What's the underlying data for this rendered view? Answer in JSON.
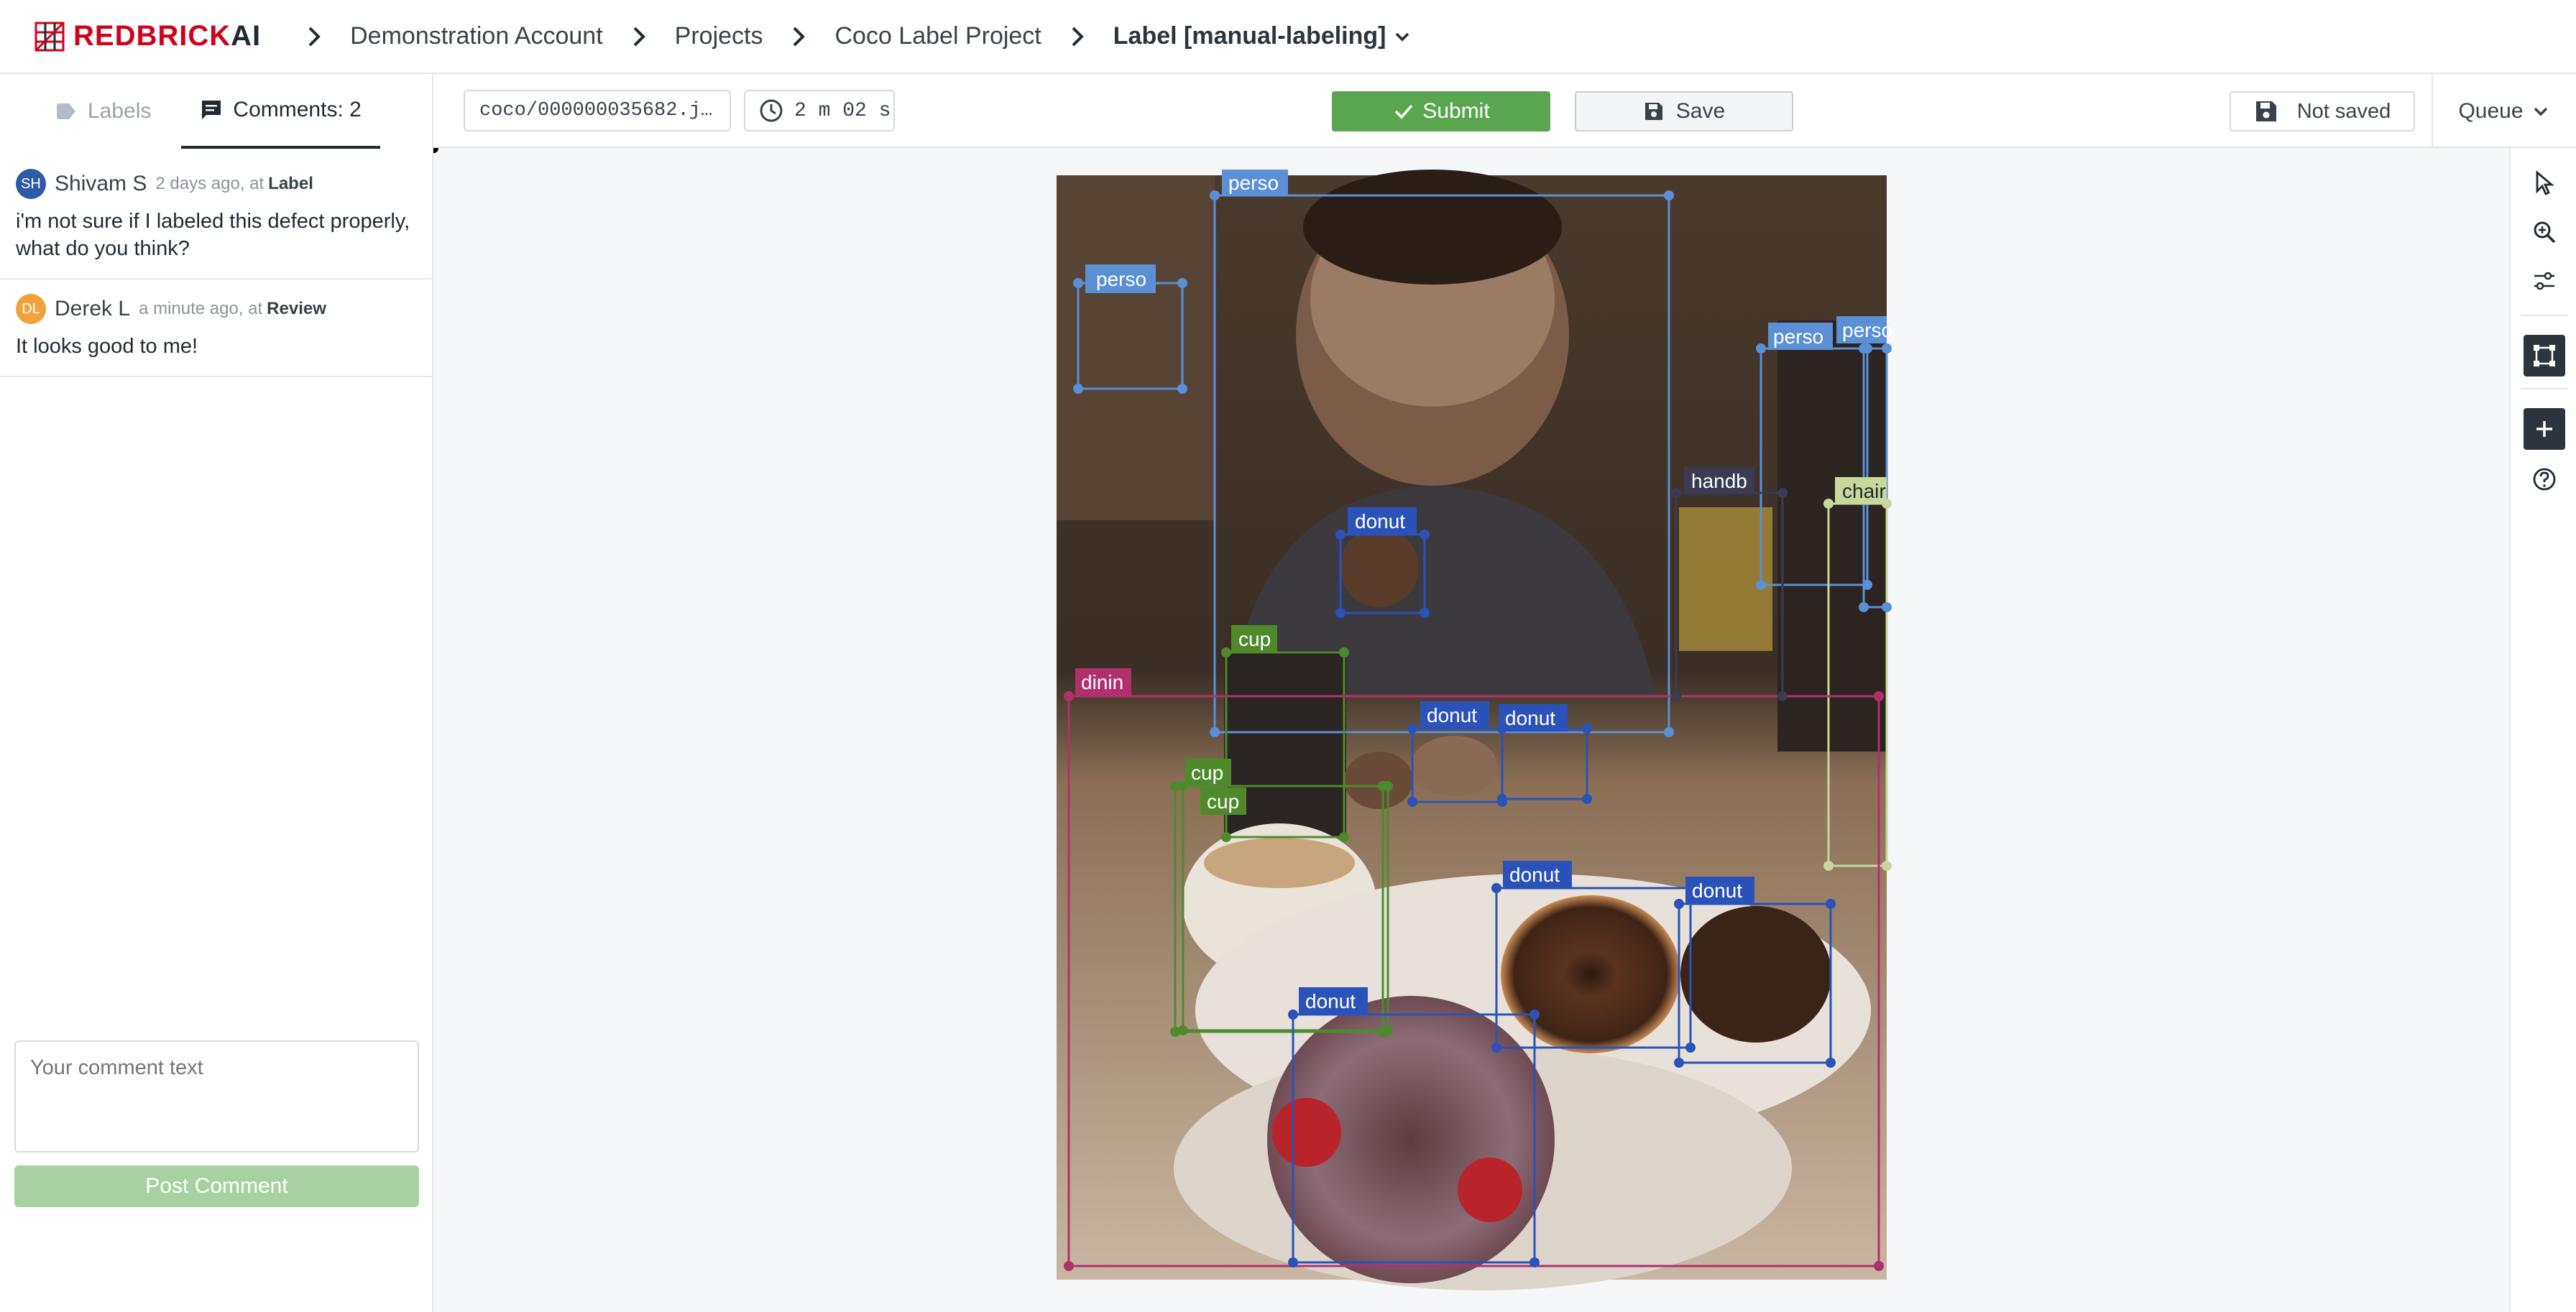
{
  "brand": {
    "logo_red": "REDBRICK",
    "logo_dark": "AI"
  },
  "breadcrumbs": {
    "items": [
      "Demonstration Account",
      "Projects",
      "Coco Label Project"
    ],
    "current": "Label [manual-labeling]"
  },
  "sidebar": {
    "tabs": [
      {
        "label": "Labels"
      },
      {
        "label": "Comments: 2"
      }
    ],
    "comments": [
      {
        "initials": "SH",
        "author": "Shivam S",
        "meta": "2 days ago, at",
        "stage": "Label",
        "text": "i'm not sure if I labeled this defect properly, what do you think?",
        "avatar_color": "#2d5ba8"
      },
      {
        "initials": "DL",
        "author": "Derek L",
        "meta": "a minute ago, at",
        "stage": "Review",
        "text": "It looks good to me!",
        "avatar_color": "#f2a23a"
      }
    ],
    "comment_placeholder": "Your comment text",
    "post_label": "Post Comment"
  },
  "toolbar": {
    "filename": "coco/000000035682.j…",
    "timer": "2 m 02 s",
    "submit_label": "Submit",
    "save_label": "Save",
    "save_status": "Not saved",
    "queue_label": "Queue"
  },
  "canvas": {
    "labels": {
      "person_main": "perso",
      "person_small": "perso",
      "person_right1": "perso",
      "person_right2": "perso",
      "handbag": "handb",
      "chair": "chair",
      "donut_top": "donut",
      "cup1": "cup",
      "cup2": "cup",
      "cup3": "cup",
      "dining_table": "dinin",
      "donut_a": "donut",
      "donut_b": "donut",
      "donut_c": "donut",
      "donut_d": "donut",
      "donut_e": "donut"
    }
  },
  "colors": {
    "person": "#5b8fd6",
    "donut": "#2b52b8",
    "cup": "#4e8a2c",
    "dining_table": "#b0306e",
    "handbag": "#3b3b52",
    "chair": "#c8d79a",
    "submit": "#5aa650"
  },
  "right_tools": [
    "cursor-icon",
    "zoom-icon",
    "sliders-icon",
    "bounding-box-icon",
    "plus-icon",
    "help-icon"
  ]
}
